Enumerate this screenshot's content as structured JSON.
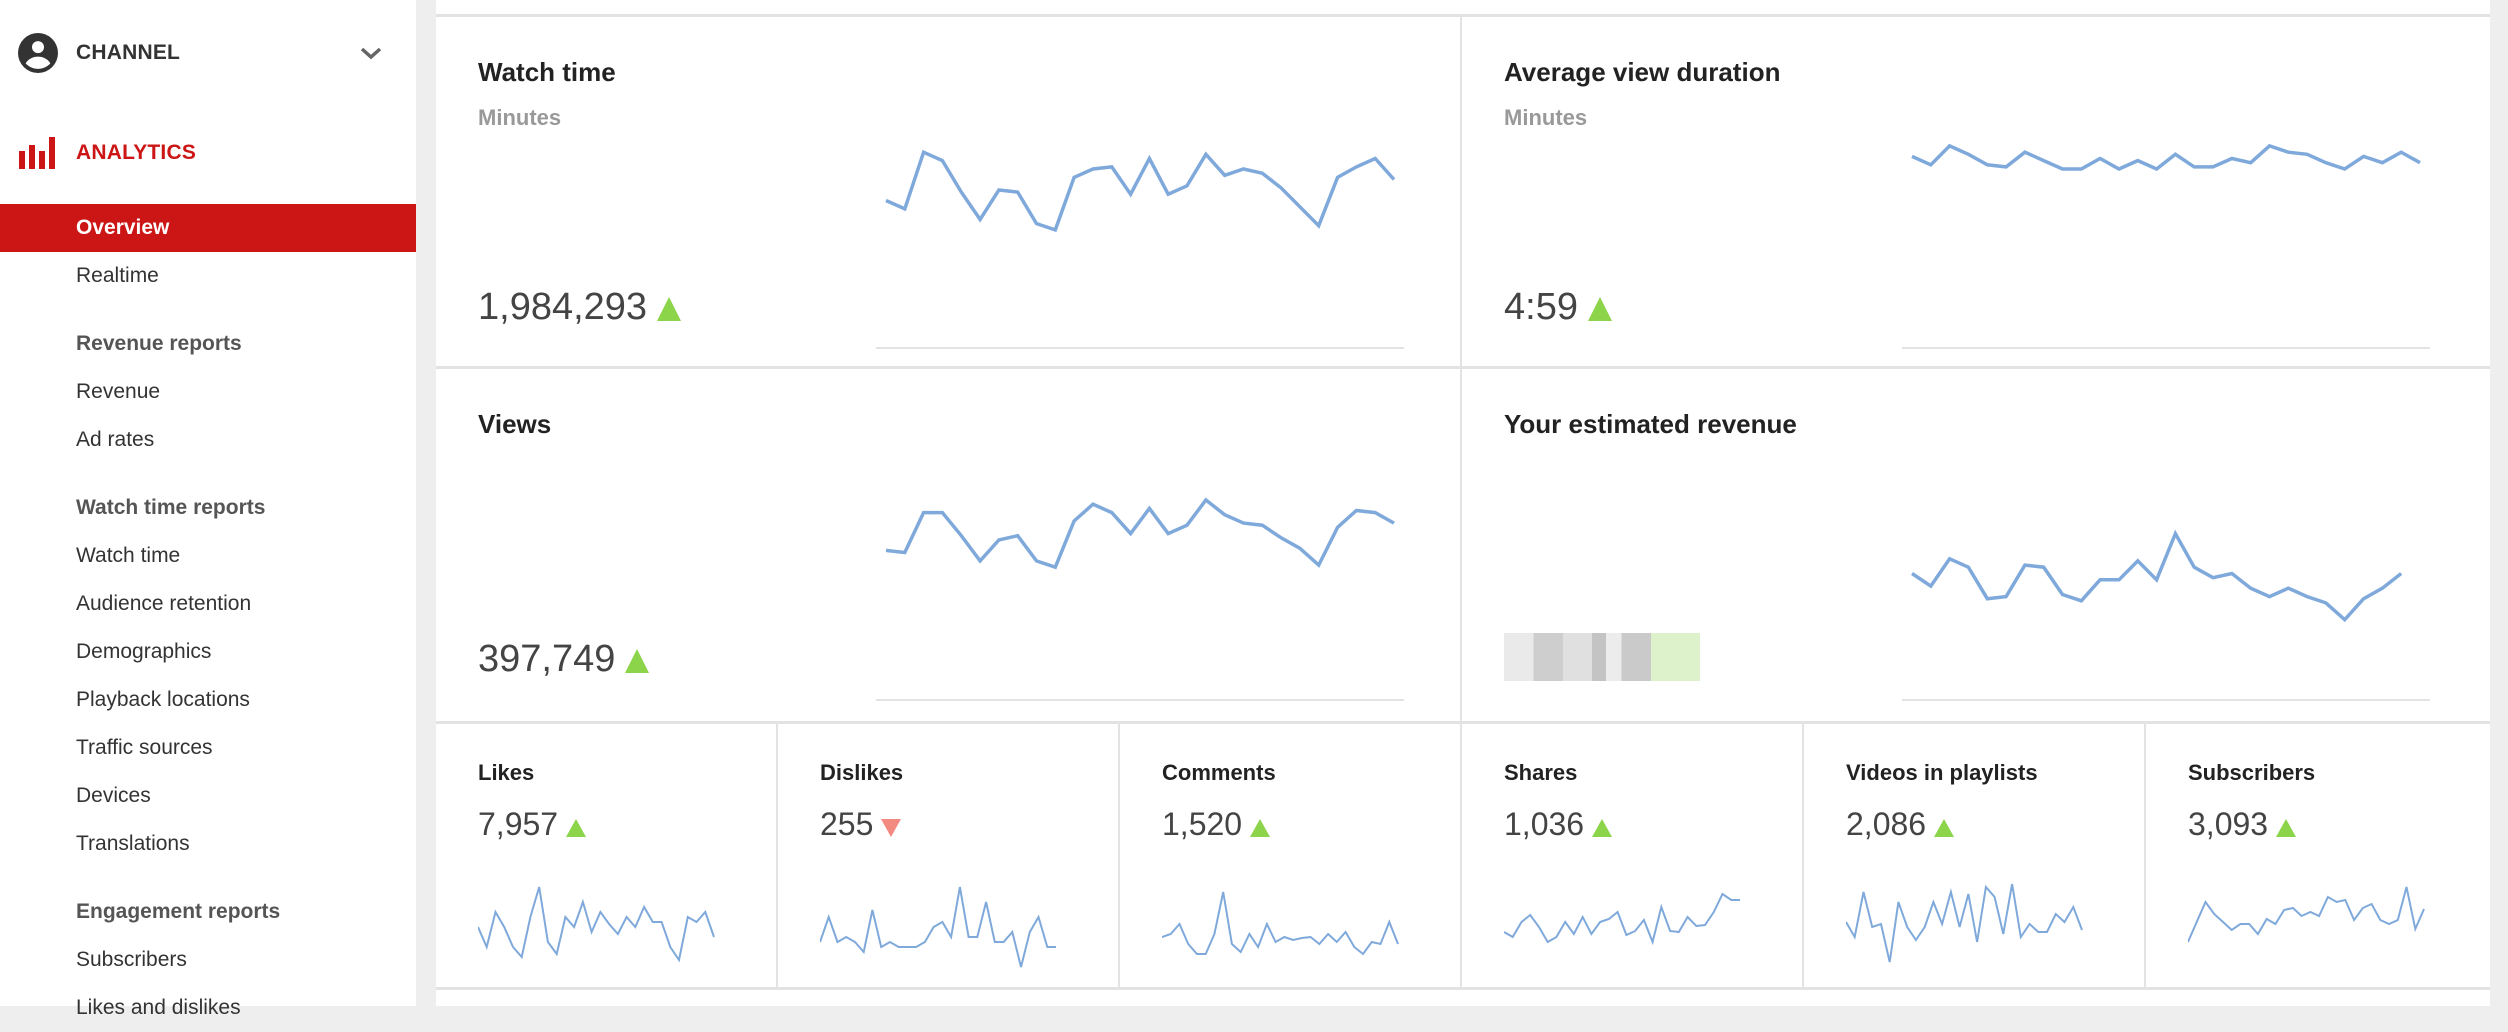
{
  "sidebar": {
    "channel_label": "CHANNEL",
    "analytics_label": "ANALYTICS",
    "items": [
      {
        "type": "item",
        "label": "Overview",
        "active": true
      },
      {
        "type": "item",
        "label": "Realtime"
      },
      {
        "type": "section",
        "label": "Revenue reports"
      },
      {
        "type": "item",
        "label": "Revenue"
      },
      {
        "type": "item",
        "label": "Ad rates"
      },
      {
        "type": "section",
        "label": "Watch time reports"
      },
      {
        "type": "item",
        "label": "Watch time"
      },
      {
        "type": "item",
        "label": "Audience retention"
      },
      {
        "type": "item",
        "label": "Demographics"
      },
      {
        "type": "item",
        "label": "Playback locations"
      },
      {
        "type": "item",
        "label": "Traffic sources"
      },
      {
        "type": "item",
        "label": "Devices"
      },
      {
        "type": "item",
        "label": "Translations"
      },
      {
        "type": "section",
        "label": "Engagement reports"
      },
      {
        "type": "item",
        "label": "Subscribers"
      },
      {
        "type": "item",
        "label": "Likes and dislikes"
      }
    ]
  },
  "colors": {
    "accent_red": "#cc1515",
    "trend_up": "#8cd44a",
    "trend_down": "#f28a80",
    "spark_line": "#7fa9db"
  },
  "big_metrics": [
    {
      "title": "Watch time",
      "subtitle": "Minutes",
      "value": "1,984,293",
      "trend": "up"
    },
    {
      "title": "Average view duration",
      "subtitle": "Minutes",
      "value": "4:59",
      "trend": "up"
    },
    {
      "title": "Views",
      "subtitle": "",
      "value": "397,749",
      "trend": "up"
    },
    {
      "title": "Your estimated revenue",
      "subtitle": "",
      "value": "",
      "trend": "up",
      "redacted": true
    }
  ],
  "small_metrics": [
    {
      "title": "Likes",
      "value": "7,957",
      "trend": "up"
    },
    {
      "title": "Dislikes",
      "value": "255",
      "trend": "down"
    },
    {
      "title": "Comments",
      "value": "1,520",
      "trend": "up"
    },
    {
      "title": "Shares",
      "value": "1,036",
      "trend": "up"
    },
    {
      "title": "Videos in playlists",
      "value": "2,086",
      "trend": "up"
    },
    {
      "title": "Subscribers",
      "value": "3,093",
      "trend": "up"
    }
  ],
  "chart_data": [
    {
      "type": "line",
      "title": "Watch time",
      "ylim": [
        0,
        100
      ],
      "values": [
        65,
        61,
        88,
        84,
        69,
        56,
        70,
        69,
        54,
        51,
        76,
        80,
        81,
        68,
        85,
        68,
        72,
        87,
        77,
        80,
        78,
        71,
        62,
        53,
        76,
        81,
        85,
        75
      ]
    },
    {
      "type": "line",
      "title": "Average view duration",
      "ylim": [
        0,
        100
      ],
      "values": [
        86,
        82,
        91,
        87,
        82,
        81,
        88,
        84,
        80,
        80,
        85,
        80,
        84,
        80,
        87,
        81,
        81,
        85,
        83,
        91,
        88,
        87,
        83,
        80,
        86,
        83,
        88,
        83
      ]
    },
    {
      "type": "line",
      "title": "Views",
      "ylim": [
        0,
        100
      ],
      "values": [
        66,
        65,
        84,
        84,
        73,
        61,
        71,
        73,
        61,
        58,
        80,
        88,
        84,
        74,
        86,
        74,
        78,
        90,
        83,
        79,
        78,
        72,
        67,
        59,
        77,
        85,
        84,
        79
      ]
    },
    {
      "type": "line",
      "title": "Your estimated revenue",
      "ylim": [
        0,
        100
      ],
      "values": [
        55,
        49,
        62,
        58,
        43,
        44,
        59,
        58,
        45,
        42,
        52,
        52,
        61,
        52,
        74,
        58,
        53,
        55,
        48,
        44,
        48,
        44,
        41,
        33,
        43,
        48,
        55
      ]
    },
    {
      "type": "line",
      "title": "Likes",
      "ylim": [
        0,
        100
      ],
      "values": [
        45,
        25,
        60,
        45,
        25,
        15,
        55,
        85,
        30,
        18,
        55,
        45,
        70,
        40,
        60,
        48,
        38,
        55,
        45,
        65,
        50,
        50,
        25,
        12,
        55,
        50,
        60,
        35
      ]
    },
    {
      "type": "line",
      "title": "Dislikes",
      "ylim": [
        0,
        100
      ],
      "values": [
        30,
        55,
        30,
        35,
        30,
        20,
        62,
        25,
        30,
        25,
        25,
        25,
        30,
        45,
        50,
        35,
        85,
        35,
        35,
        70,
        30,
        30,
        40,
        5,
        40,
        55,
        25,
        25
      ]
    },
    {
      "type": "line",
      "title": "Comments",
      "ylim": [
        0,
        100
      ],
      "values": [
        35,
        38,
        48,
        28,
        18,
        18,
        38,
        80,
        28,
        20,
        38,
        25,
        48,
        30,
        35,
        32,
        34,
        35,
        28,
        38,
        30,
        40,
        25,
        18,
        30,
        28,
        50,
        28
      ]
    },
    {
      "type": "line",
      "title": "Shares",
      "ylim": [
        0,
        100
      ],
      "values": [
        40,
        35,
        50,
        57,
        45,
        30,
        35,
        50,
        38,
        55,
        38,
        50,
        53,
        60,
        37,
        41,
        52,
        30,
        65,
        41,
        40,
        55,
        46,
        47,
        60,
        78,
        72,
        72
      ]
    },
    {
      "type": "line",
      "title": "Videos in playlists",
      "ylim": [
        0,
        100
      ],
      "values": [
        50,
        35,
        80,
        45,
        48,
        10,
        70,
        45,
        32,
        45,
        70,
        48,
        80,
        45,
        78,
        30,
        85,
        75,
        38,
        88,
        35,
        48,
        40,
        40,
        58,
        50,
        65,
        42
      ]
    },
    {
      "type": "line",
      "title": "Subscribers",
      "ylim": [
        0,
        100
      ],
      "values": [
        30,
        50,
        70,
        58,
        50,
        42,
        48,
        48,
        38,
        53,
        48,
        62,
        64,
        56,
        60,
        56,
        75,
        70,
        72,
        52,
        64,
        68,
        52,
        48,
        52,
        85,
        43,
        63
      ]
    }
  ]
}
